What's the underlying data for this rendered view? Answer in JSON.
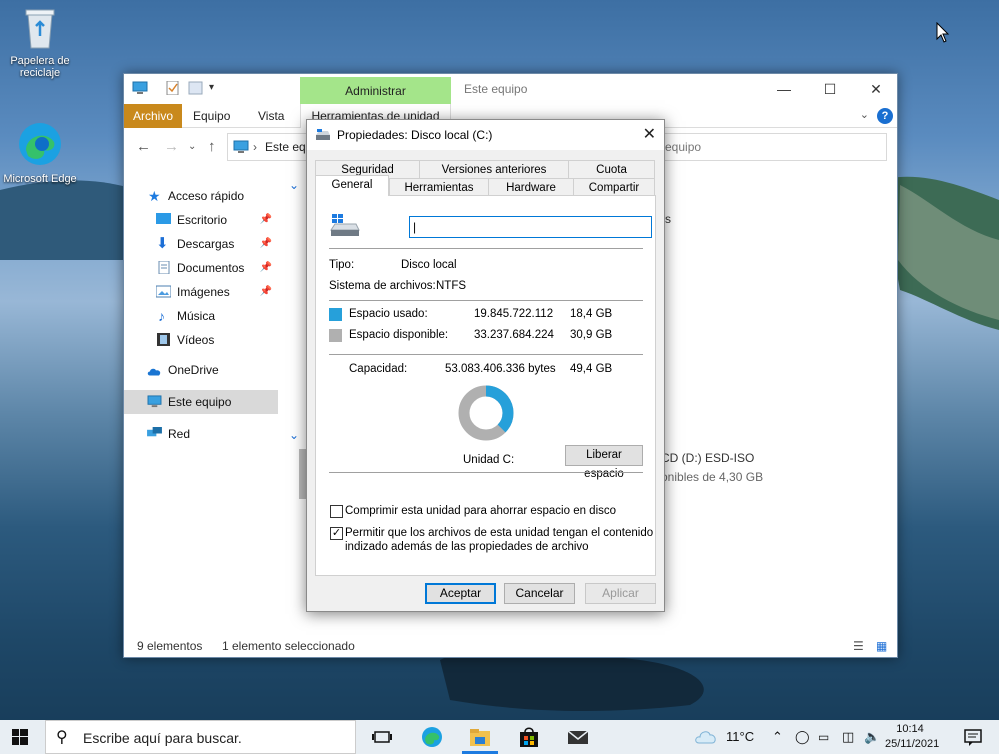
{
  "desktop": {
    "recycle_bin_label": "Papelera de reciclaje",
    "edge_label": "Microsoft Edge"
  },
  "explorer": {
    "context_tab_top": "Administrar",
    "title": "Este equipo",
    "ribbon_tabs": [
      "Archivo",
      "Equipo",
      "Vista",
      "Herramientas de unidad"
    ],
    "address": "Este equipo",
    "search_placeholder": "equipo",
    "nav": {
      "quick_access": "Acceso rápido",
      "items": [
        "Escritorio",
        "Descargas",
        "Documentos",
        "Imágenes",
        "Música",
        "Vídeos"
      ],
      "onedrive": "OneDrive",
      "this_pc": "Este equipo",
      "network": "Red"
    },
    "content": {
      "drive_partial": "CD (D:) ESD-ISO",
      "drive_free_partial": "onibles de 4,30 GB",
      "fragment_s": "s"
    },
    "status": {
      "count": "9 elementos",
      "selected": "1 elemento seleccionado"
    }
  },
  "dialog": {
    "title": "Propiedades: Disco local (C:)",
    "tabs_row1": [
      "Seguridad",
      "Versiones anteriores",
      "Cuota"
    ],
    "tabs_row2": [
      "General",
      "Herramientas",
      "Hardware",
      "Compartir"
    ],
    "name_value": "",
    "type_label": "Tipo:",
    "type_value": "Disco local",
    "fs_label": "Sistema de archivos:",
    "fs_value": "NTFS",
    "used": {
      "label": "Espacio usado:",
      "bytes": "19.845.722.112",
      "size": "18,4 GB",
      "color": "#26a0da"
    },
    "free": {
      "label": "Espacio disponible:",
      "bytes": "33.237.684.224",
      "size": "30,9 GB",
      "color": "#b0b0b0"
    },
    "capacity": {
      "label": "Capacidad:",
      "bytes": "53.083.406.336 bytes",
      "size": "49,4 GB"
    },
    "used_fraction": 0.374,
    "drive_label": "Unidad C:",
    "cleanup_button": "Liberar espacio",
    "compress_label": "Comprimir esta unidad para ahorrar espacio en disco",
    "compress_checked": false,
    "index_label_1": "Permitir que los archivos de esta unidad tengan el contenido",
    "index_label_2": "indizado además de las propiedades de archivo",
    "index_checked": true,
    "buttons": {
      "ok": "Aceptar",
      "cancel": "Cancelar",
      "apply": "Aplicar"
    }
  },
  "taskbar": {
    "search_placeholder": "Escribe aquí para buscar.",
    "weather": "11°C",
    "time": "10:14",
    "date": "25/11/2021"
  }
}
